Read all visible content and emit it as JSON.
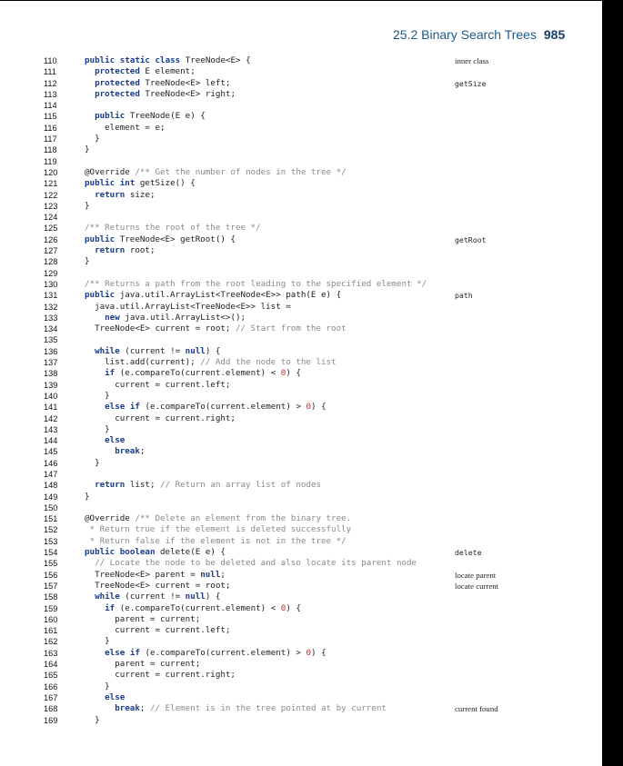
{
  "header": {
    "section": "25.2 Binary Search Trees",
    "page": "985"
  },
  "lines": [
    {
      "n": "110",
      "t": "public static class TreeNode<E> {",
      "note": "inner class",
      "nm": 0
    },
    {
      "n": "111",
      "t": "  protected E element;",
      "note": "",
      "nm": 0
    },
    {
      "n": "112",
      "t": "  protected TreeNode<E> left;",
      "note": "getSize",
      "nm": 1
    },
    {
      "n": "113",
      "t": "  protected TreeNode<E> right;",
      "note": "",
      "nm": 0
    },
    {
      "n": "114",
      "t": "",
      "note": "",
      "nm": 0
    },
    {
      "n": "115",
      "t": "  public TreeNode(E e) {",
      "note": "",
      "nm": 0
    },
    {
      "n": "116",
      "t": "    element = e;",
      "note": "",
      "nm": 0
    },
    {
      "n": "117",
      "t": "  }",
      "note": "",
      "nm": 0
    },
    {
      "n": "118",
      "t": "}",
      "note": "",
      "nm": 0
    },
    {
      "n": "119",
      "t": "",
      "note": "",
      "nm": 0
    },
    {
      "n": "120",
      "t": "@Override /** Get the number of nodes in the tree */",
      "note": "",
      "nm": 0
    },
    {
      "n": "121",
      "t": "public int getSize() {",
      "note": "",
      "nm": 0
    },
    {
      "n": "122",
      "t": "  return size;",
      "note": "",
      "nm": 0
    },
    {
      "n": "123",
      "t": "}",
      "note": "",
      "nm": 0
    },
    {
      "n": "124",
      "t": "",
      "note": "",
      "nm": 0
    },
    {
      "n": "125",
      "t": "/** Returns the root of the tree */",
      "note": "",
      "nm": 0
    },
    {
      "n": "126",
      "t": "public TreeNode<E> getRoot() {",
      "note": "getRoot",
      "nm": 1
    },
    {
      "n": "127",
      "t": "  return root;",
      "note": "",
      "nm": 0
    },
    {
      "n": "128",
      "t": "}",
      "note": "",
      "nm": 0
    },
    {
      "n": "129",
      "t": "",
      "note": "",
      "nm": 0
    },
    {
      "n": "130",
      "t": "/** Returns a path from the root leading to the specified element */",
      "note": "",
      "nm": 0
    },
    {
      "n": "131",
      "t": "public java.util.ArrayList<TreeNode<E>> path(E e) {",
      "note": "path",
      "nm": 1
    },
    {
      "n": "132",
      "t": "  java.util.ArrayList<TreeNode<E>> list =",
      "note": "",
      "nm": 0
    },
    {
      "n": "133",
      "t": "    new java.util.ArrayList<>();",
      "note": "",
      "nm": 0
    },
    {
      "n": "134",
      "t": "  TreeNode<E> current = root; // Start from the root",
      "note": "",
      "nm": 0
    },
    {
      "n": "135",
      "t": "",
      "note": "",
      "nm": 0
    },
    {
      "n": "136",
      "t": "  while (current != null) {",
      "note": "",
      "nm": 0
    },
    {
      "n": "137",
      "t": "    list.add(current); // Add the node to the list",
      "note": "",
      "nm": 0
    },
    {
      "n": "138",
      "t": "    if (e.compareTo(current.element) < 0) {",
      "note": "",
      "nm": 0
    },
    {
      "n": "139",
      "t": "      current = current.left;",
      "note": "",
      "nm": 0
    },
    {
      "n": "140",
      "t": "    }",
      "note": "",
      "nm": 0
    },
    {
      "n": "141",
      "t": "    else if (e.compareTo(current.element) > 0) {",
      "note": "",
      "nm": 0
    },
    {
      "n": "142",
      "t": "      current = current.right;",
      "note": "",
      "nm": 0
    },
    {
      "n": "143",
      "t": "    }",
      "note": "",
      "nm": 0
    },
    {
      "n": "144",
      "t": "    else",
      "note": "",
      "nm": 0
    },
    {
      "n": "145",
      "t": "      break;",
      "note": "",
      "nm": 0
    },
    {
      "n": "146",
      "t": "  }",
      "note": "",
      "nm": 0
    },
    {
      "n": "147",
      "t": "",
      "note": "",
      "nm": 0
    },
    {
      "n": "148",
      "t": "  return list; // Return an array list of nodes",
      "note": "",
      "nm": 0
    },
    {
      "n": "149",
      "t": "}",
      "note": "",
      "nm": 0
    },
    {
      "n": "150",
      "t": "",
      "note": "",
      "nm": 0
    },
    {
      "n": "151",
      "t": "@Override /** Delete an element from the binary tree.",
      "note": "",
      "nm": 0
    },
    {
      "n": "152",
      "t": " * Return true if the element is deleted successfully",
      "note": "",
      "nm": 0
    },
    {
      "n": "153",
      "t": " * Return false if the element is not in the tree */",
      "note": "",
      "nm": 0
    },
    {
      "n": "154",
      "t": "public boolean delete(E e) {",
      "note": "delete",
      "nm": 1
    },
    {
      "n": "155",
      "t": "  // Locate the node to be deleted and also locate its parent node",
      "note": "",
      "nm": 0
    },
    {
      "n": "156",
      "t": "  TreeNode<E> parent = null;",
      "note": "locate parent",
      "nm": 0
    },
    {
      "n": "157",
      "t": "  TreeNode<E> current = root;",
      "note": "locate current",
      "nm": 0
    },
    {
      "n": "158",
      "t": "  while (current != null) {",
      "note": "",
      "nm": 0
    },
    {
      "n": "159",
      "t": "    if (e.compareTo(current.element) < 0) {",
      "note": "",
      "nm": 0
    },
    {
      "n": "160",
      "t": "      parent = current;",
      "note": "",
      "nm": 0
    },
    {
      "n": "161",
      "t": "      current = current.left;",
      "note": "",
      "nm": 0
    },
    {
      "n": "162",
      "t": "    }",
      "note": "",
      "nm": 0
    },
    {
      "n": "163",
      "t": "    else if (e.compareTo(current.element) > 0) {",
      "note": "",
      "nm": 0
    },
    {
      "n": "164",
      "t": "      parent = current;",
      "note": "",
      "nm": 0
    },
    {
      "n": "165",
      "t": "      current = current.right;",
      "note": "",
      "nm": 0
    },
    {
      "n": "166",
      "t": "    }",
      "note": "",
      "nm": 0
    },
    {
      "n": "167",
      "t": "    else",
      "note": "",
      "nm": 0
    },
    {
      "n": "168",
      "t": "      break; // Element is in the tree pointed at by current",
      "note": "current found",
      "nm": 0
    },
    {
      "n": "169",
      "t": "  }",
      "note": "",
      "nm": 0
    }
  ]
}
